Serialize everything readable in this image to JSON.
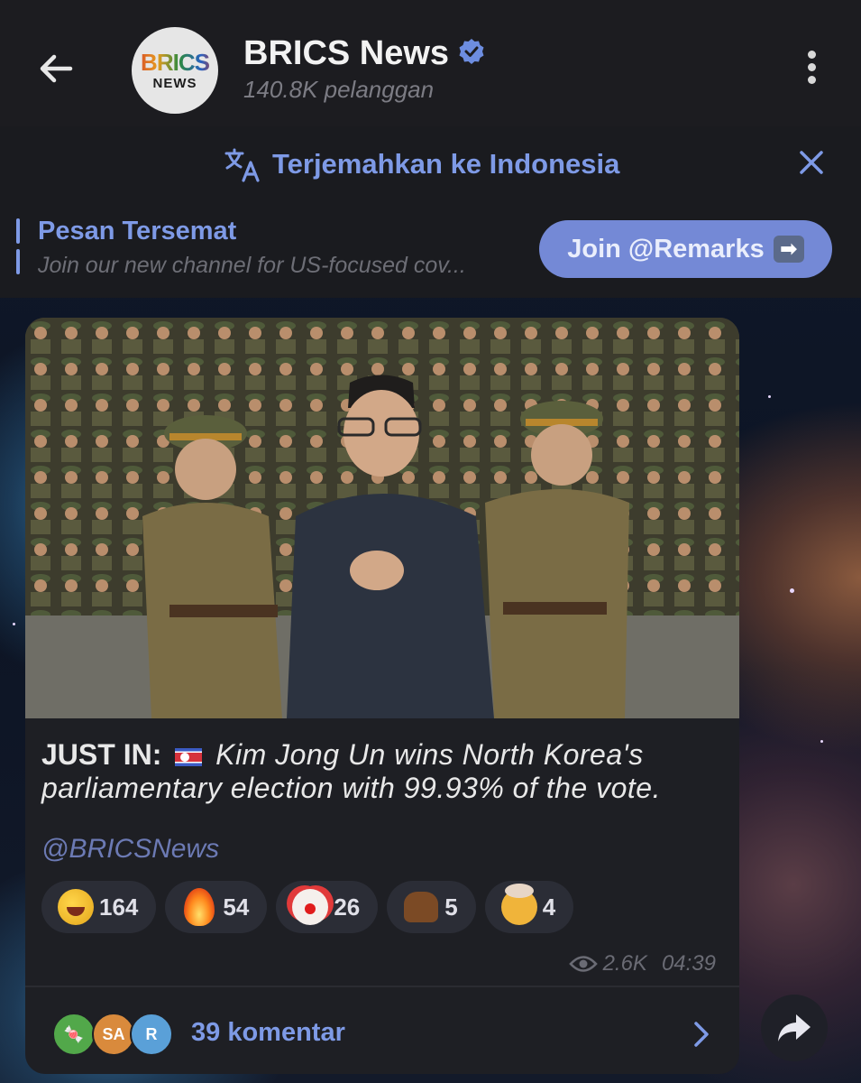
{
  "header": {
    "channel_name": "BRICS News",
    "subscribers": "140.8K pelanggan",
    "avatar_line1": "BRICS",
    "avatar_line2": "NEWS"
  },
  "translate": {
    "label": "Terjemahkan ke Indonesia"
  },
  "pinned": {
    "title": "Pesan Tersemat",
    "text": "Join our new channel for US-focused cov...",
    "join_button": "Join @Remarks",
    "join_arrow": "➡"
  },
  "message": {
    "lead": "JUST IN:",
    "body": "Kim Jong Un wins North Korea's parliamentary election with 99.93% of the vote.",
    "mention": "@BRICSNews",
    "reactions": [
      {
        "emoji": "rolling-on-floor-laughing",
        "count": "164"
      },
      {
        "emoji": "fire",
        "count": "54"
      },
      {
        "emoji": "clown-face",
        "count": "26"
      },
      {
        "emoji": "pile-of-poo",
        "count": "5"
      },
      {
        "emoji": "exploding-head",
        "count": "4"
      }
    ],
    "views": "2.6K",
    "time": "04:39"
  },
  "comments": {
    "label": "39 komentar",
    "avatars": [
      {
        "text": "🍬",
        "color": "#52a84a"
      },
      {
        "text": "SA",
        "color": "#d98a3c"
      },
      {
        "text": "R",
        "color": "#5aa0d8"
      }
    ]
  },
  "colors": {
    "accent": "#7e9ae6",
    "header_bg": "#1c1c20",
    "bubble_bg": "#1e1f24"
  }
}
